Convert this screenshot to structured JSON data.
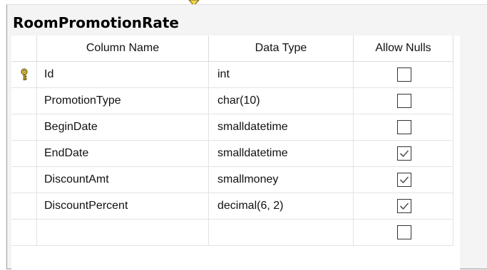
{
  "table": {
    "title": "RoomPromotionRate"
  },
  "grid": {
    "headers": {
      "column_name": "Column Name",
      "data_type": "Data Type",
      "allow_nulls": "Allow Nulls"
    },
    "rows": [
      {
        "name": "Id",
        "type": "int",
        "allow_nulls": false,
        "primary_key": true
      },
      {
        "name": "PromotionType",
        "type": "char(10)",
        "allow_nulls": false,
        "primary_key": false
      },
      {
        "name": "BeginDate",
        "type": "smalldatetime",
        "allow_nulls": false,
        "primary_key": false
      },
      {
        "name": "EndDate",
        "type": "smalldatetime",
        "allow_nulls": true,
        "primary_key": false
      },
      {
        "name": "DiscountAmt",
        "type": "smallmoney",
        "allow_nulls": true,
        "primary_key": false
      },
      {
        "name": "DiscountPercent",
        "type": "decimal(6, 2)",
        "allow_nulls": true,
        "primary_key": false
      },
      {
        "name": "",
        "type": "",
        "allow_nulls": false,
        "primary_key": false
      }
    ]
  },
  "icons": {
    "primary_key": "key-icon",
    "connector": "relationship-connector-icon",
    "checkbox_check": "check-icon"
  },
  "colors": {
    "key_gold": "#e7c23a",
    "key_outline": "#6b5a12",
    "grid_line": "#e3e3e3",
    "window_bg": "#f4f4f4",
    "check_color": "#555555"
  }
}
